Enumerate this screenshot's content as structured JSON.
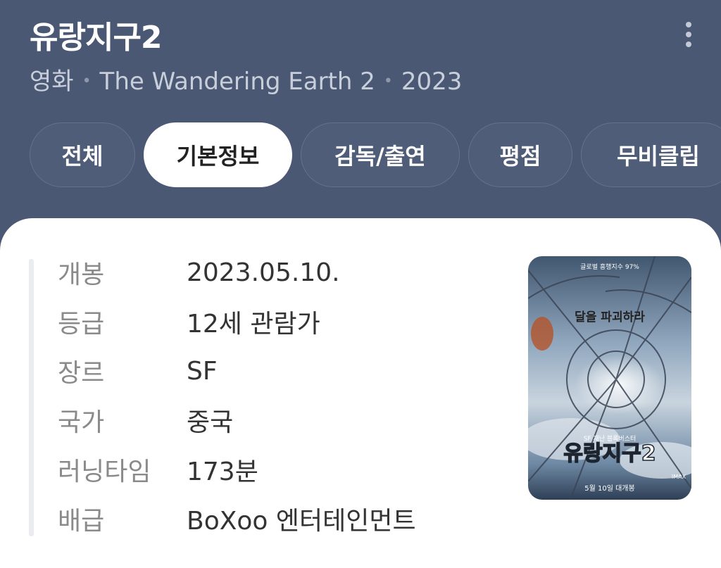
{
  "header": {
    "title": "유랑지구2",
    "subtitle": {
      "type": "영화",
      "original_title": "The Wandering Earth 2",
      "year": "2023"
    }
  },
  "tabs": [
    {
      "label": "전체",
      "active": false
    },
    {
      "label": "기본정보",
      "active": true
    },
    {
      "label": "감독/출연",
      "active": false
    },
    {
      "label": "평점",
      "active": false
    },
    {
      "label": "무비클립",
      "active": false
    }
  ],
  "info": [
    {
      "label": "개봉",
      "value": "2023.05.10."
    },
    {
      "label": "등급",
      "value": "12세 관람가"
    },
    {
      "label": "장르",
      "value": "SF"
    },
    {
      "label": "국가",
      "value": "중국"
    },
    {
      "label": "러닝타임",
      "value": "173분"
    },
    {
      "label": "배급",
      "value": "BoXoo 엔터테인먼트"
    }
  ],
  "poster": {
    "top_text": "글로벌 흥행지수 97%",
    "tagline": "달을 파괴하라",
    "small_text": "SF 재난 블록버스터",
    "title": "유랑지구2",
    "imax": "IMAX",
    "release": "5월 10일 대개봉"
  }
}
